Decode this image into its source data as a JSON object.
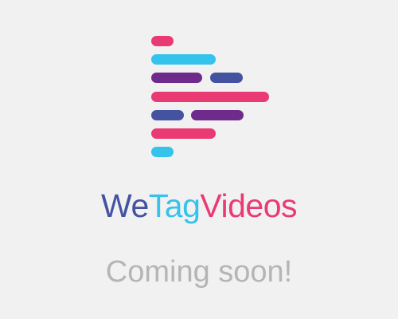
{
  "brand": {
    "name_parts": [
      {
        "text": "We",
        "color": "#4352a1"
      },
      {
        "text": "Tag",
        "color": "#34c3ea"
      },
      {
        "text": "Videos",
        "color": "#ea3a73"
      }
    ],
    "mark_icon": "play-arrow-bars-icon"
  },
  "status": {
    "message": "Coming soon!"
  },
  "colors": {
    "background": "#f2f1f1",
    "pink": "#ea3a73",
    "cyan": "#34c3ea",
    "purple": "#6e2b8c",
    "blue": "#4352a1",
    "muted_text": "#b5b5b5"
  }
}
